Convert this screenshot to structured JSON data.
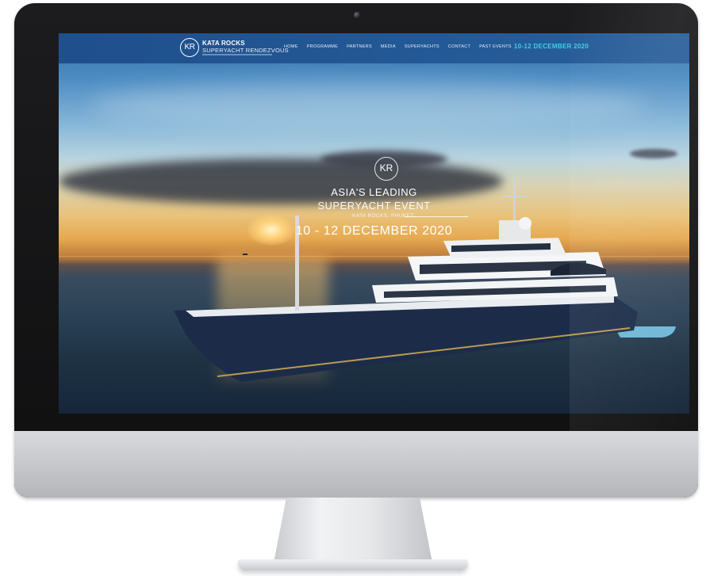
{
  "nav": {
    "logo_initials": "KR",
    "logo_line1": "KATA ROCKS",
    "logo_line2": "SUPERYACHT RENDEZVOUS",
    "items": [
      {
        "label": "HOME"
      },
      {
        "label": "PROGRAMME"
      },
      {
        "label": "PARTNERS"
      },
      {
        "label": "MEDIA"
      },
      {
        "label": "SUPERYACHTS"
      },
      {
        "label": "CONTACT"
      },
      {
        "label": "PAST EVENTS"
      }
    ],
    "date": "10-12 DECEMBER 2020"
  },
  "hero": {
    "badge_initials": "KR",
    "title_line1": "ASIA'S LEADING",
    "title_line2": "SUPERYACHT EVENT",
    "location": "KATA ROCKS, PHUKET",
    "date": "10 - 12 DECEMBER 2020"
  },
  "colors": {
    "navbar": "#1f4f8c",
    "accent_date": "#3fd0e6",
    "hull": "#1c2c48"
  },
  "icons": {
    "logo": "kr-monogram-circle",
    "camera": "webcam-dot"
  }
}
